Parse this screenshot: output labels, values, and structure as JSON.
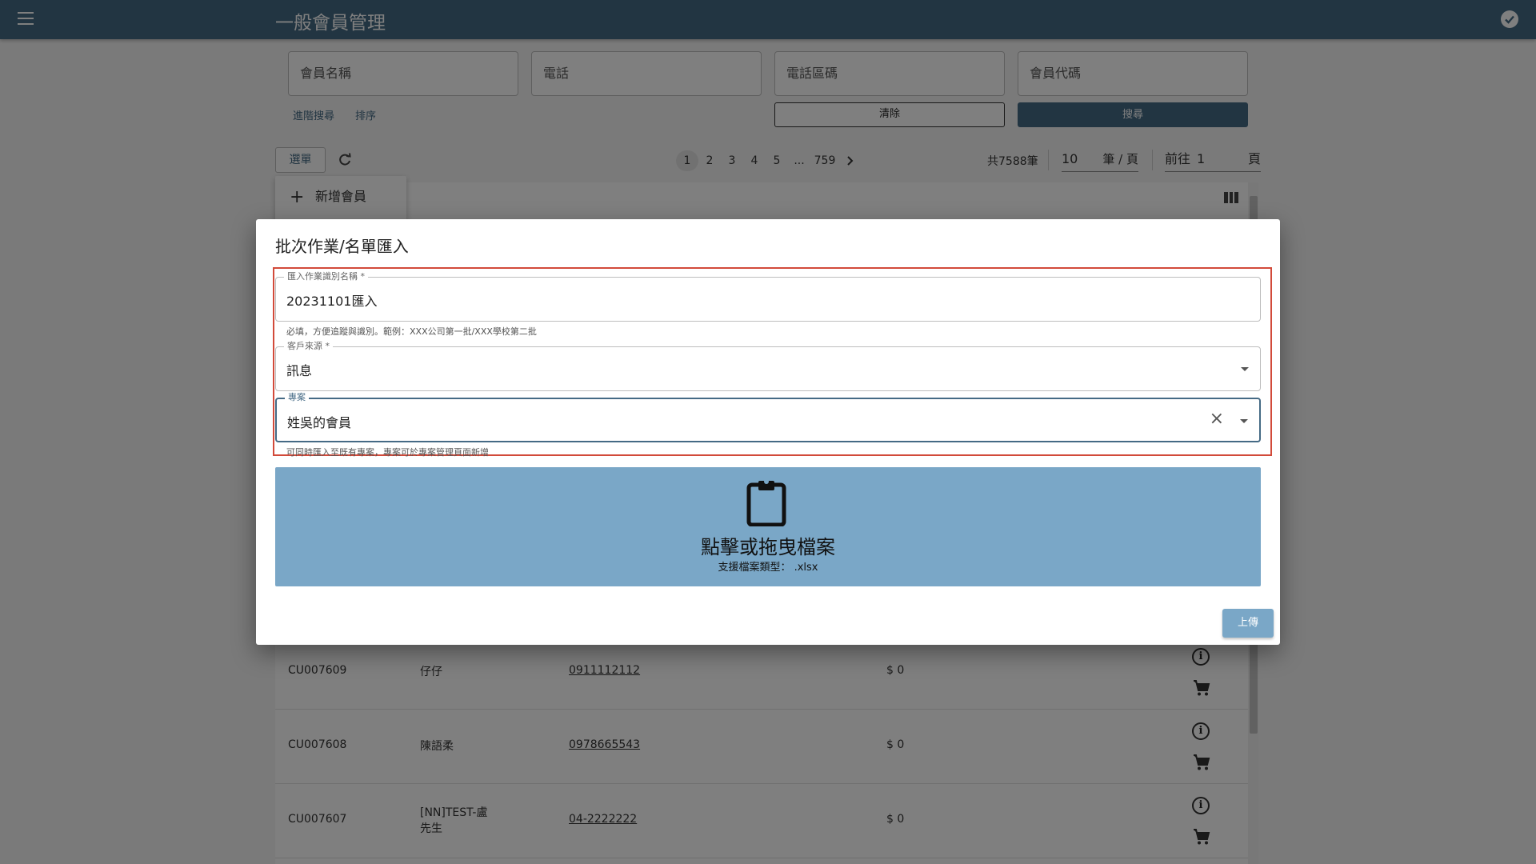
{
  "app": {
    "title": "一般會員管理"
  },
  "search": {
    "fields": [
      "會員名稱",
      "電話",
      "電話區碼",
      "會員代碼"
    ],
    "advanced_label": "進階搜尋",
    "sort_label": "排序",
    "clear_label": "清除",
    "search_label": "搜尋"
  },
  "toolbar": {
    "menu_label": "選單",
    "pages": [
      "1",
      "2",
      "3",
      "4",
      "5",
      "...",
      "759"
    ],
    "current_page": "1",
    "total_text": "共7588筆",
    "page_size": "10",
    "page_size_unit": "筆 / 頁",
    "goto_prefix": "前往",
    "goto_value": "1",
    "goto_suffix": "頁"
  },
  "dropdown": {
    "add_member_label": "新增會員"
  },
  "table": {
    "rows": [
      {
        "id": "CU007609",
        "name": "仔仔",
        "phone": "0911112112",
        "amount": "$ 0"
      },
      {
        "id": "CU007608",
        "name": "陳語柔",
        "phone": "0978665543",
        "amount": "$ 0"
      },
      {
        "id": "CU007607",
        "name": "[NN]TEST-盧先生",
        "phone": "04-2222222",
        "amount": "$ 0"
      }
    ]
  },
  "dialog": {
    "title": "批次作業/名單匯入",
    "batch_name": {
      "label": "匯入作業識別名稱 *",
      "value": "20231101匯入",
      "helper": "必填，方便追蹤與識別。範例：XXX公司第一批/XXX學校第二批"
    },
    "source": {
      "label": "客戶來源 *",
      "value": "訊息"
    },
    "project": {
      "label": "專案",
      "value": "姓吳的會員",
      "helper": "可同時匯入至既有專案，專案可於專案管理頁面新增"
    },
    "dropzone": {
      "title": "點擊或拖曳檔案",
      "subtitle": "支援檔案類型： .xlsx"
    },
    "upload_label": "上傳"
  },
  "colors": {
    "primary": "#456a85",
    "dropzone": "#7aa7c7",
    "highlight_border": "#d24a3a"
  }
}
